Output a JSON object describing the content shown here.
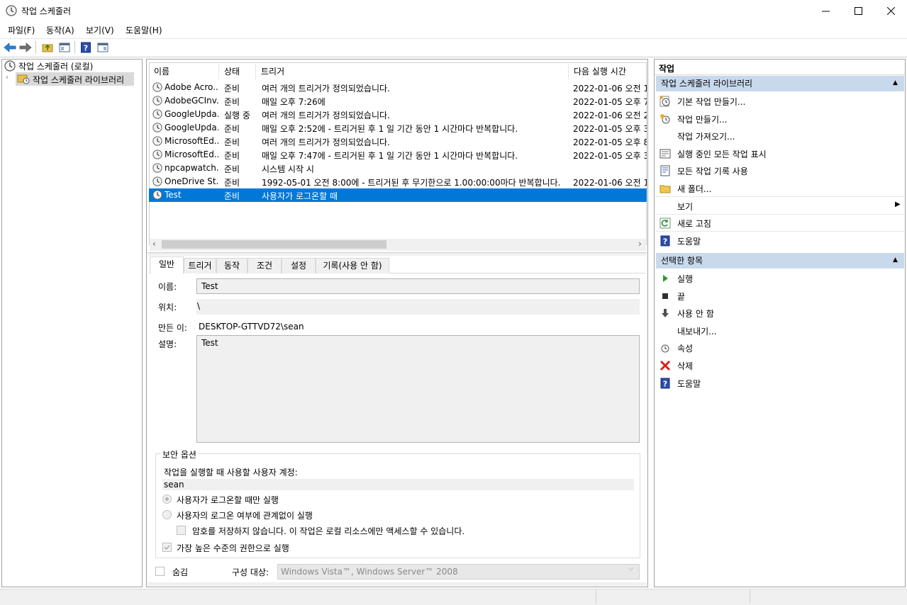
{
  "window": {
    "title": "작업 스케줄러"
  },
  "menubar": {
    "items": [
      "파일(F)",
      "동작(A)",
      "보기(V)",
      "도움말(H)"
    ]
  },
  "tree": {
    "root": "작업 스케줄러 (로컬)",
    "child": "작업 스케줄러 라이브러리"
  },
  "tasklist": {
    "columns": [
      "이름",
      "상태",
      "트리거",
      "다음 실행 시간"
    ],
    "rows": [
      {
        "name": "Adobe Acro...",
        "status": "준비",
        "trigger": "여러 개의 트리거가 정의되었습니다.",
        "next": "2022-01-06 오전 1"
      },
      {
        "name": "AdobeGCInv...",
        "status": "준비",
        "trigger": "매일 오후 7:26에",
        "next": "2022-01-05 오후 7"
      },
      {
        "name": "GoogleUpda...",
        "status": "실행 중",
        "trigger": "여러 개의 트리거가 정의되었습니다.",
        "next": "2022-01-06 오전 2"
      },
      {
        "name": "GoogleUpda...",
        "status": "준비",
        "trigger": "매일 오후 2:52에 - 트리거된 후 1 일 기간 동안 1 시간마다 반복합니다.",
        "next": "2022-01-05 오후 3"
      },
      {
        "name": "MicrosoftEd...",
        "status": "준비",
        "trigger": "여러 개의 트리거가 정의되었습니다.",
        "next": "2022-01-05 오후 8"
      },
      {
        "name": "MicrosoftEd...",
        "status": "준비",
        "trigger": "매일 오후 7:47에 - 트리거된 후 1 일 기간 동안 1 시간마다 반복합니다.",
        "next": "2022-01-05 오후 3"
      },
      {
        "name": "npcapwatch...",
        "status": "준비",
        "trigger": "시스템 시작 시",
        "next": ""
      },
      {
        "name": "OneDrive St...",
        "status": "준비",
        "trigger": "1992-05-01 오전 8:00에 - 트리거된 후 무기한으로 1.00:00:00마다 반복합니다.",
        "next": "2022-01-06 오전 1"
      },
      {
        "name": "Test",
        "status": "준비",
        "trigger": "사용자가 로그온할 때",
        "next": ""
      }
    ]
  },
  "detail": {
    "tabs": [
      "일반",
      "트리거",
      "동작",
      "조건",
      "설정",
      "기록(사용 안 함)"
    ],
    "name_label": "이름:",
    "name_value": "Test",
    "location_label": "위치:",
    "location_value": "\\",
    "author_label": "만든 이:",
    "author_value": "DESKTOP-GTTVD72\\sean",
    "description_label": "설명:",
    "description_value": "Test",
    "security_group": "보안 옵션",
    "account_label": "작업을 실행할 때 사용할 사용자 계정:",
    "account_value": "sean",
    "radio1": "사용자가 로그온할 때만 실행",
    "radio2": "사용자의 로그온 여부에 관계없이 실행",
    "no_password": "암호를 저장하지 않습니다. 이 작업은 로컬 리소스에만 액세스할 수 있습니다.",
    "highest": "가장 높은 수준의 권한으로 실행",
    "hidden": "숨김",
    "configure_label": "구성 대상:",
    "configure_value": "Windows Vista™, Windows Server™ 2008"
  },
  "actions": {
    "title": "작업",
    "section1": "작업 스케줄러 라이브러리",
    "section1_items": [
      {
        "label": "기본 작업 만들기...",
        "icon": "basic-task-icon"
      },
      {
        "label": "작업 만들기...",
        "icon": "create-task-icon"
      },
      {
        "label": "작업 가져오기...",
        "icon": ""
      },
      {
        "label": "실행 중인 모든 작업 표시",
        "icon": "running-tasks-icon"
      },
      {
        "label": "모든 작업 기록 사용",
        "icon": "history-icon"
      },
      {
        "label": "새 폴더...",
        "icon": "folder-icon"
      },
      {
        "label": "보기",
        "icon": ""
      },
      {
        "label": "새로 고침",
        "icon": "refresh-icon"
      },
      {
        "label": "도움말",
        "icon": "help-icon"
      }
    ],
    "section2": "선택한 항목",
    "section2_items": [
      {
        "label": "실행",
        "icon": "run-icon"
      },
      {
        "label": "끝",
        "icon": "stop-icon"
      },
      {
        "label": "사용 안 함",
        "icon": "disable-icon"
      },
      {
        "label": "내보내기...",
        "icon": ""
      },
      {
        "label": "속성",
        "icon": "properties-icon"
      },
      {
        "label": "삭제",
        "icon": "delete-icon"
      },
      {
        "label": "도움말",
        "icon": "help-icon"
      }
    ]
  }
}
